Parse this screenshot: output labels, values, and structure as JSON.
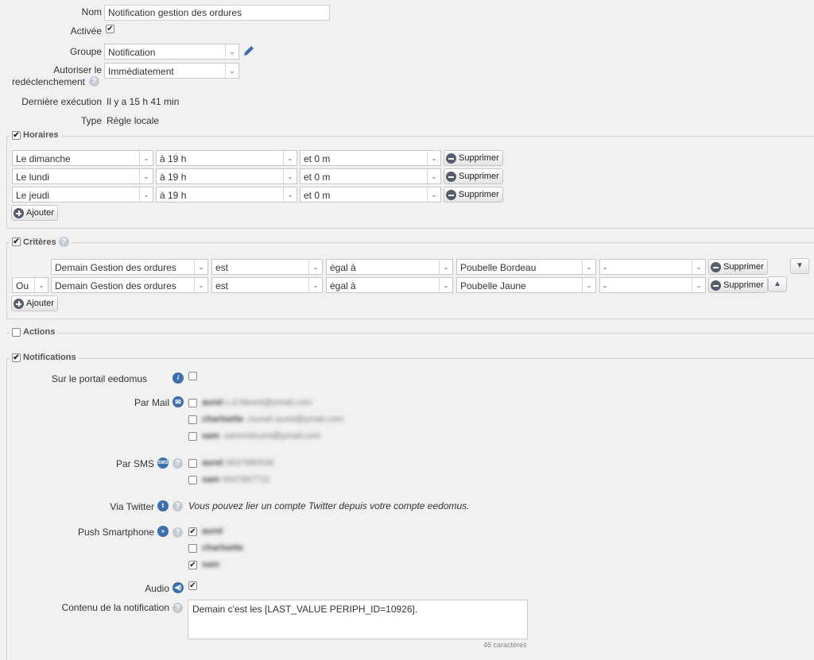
{
  "form": {
    "nom_label": "Nom",
    "nom_value": "Notification gestion des ordures",
    "activee_label": "Activée",
    "groupe_label": "Groupe",
    "groupe_value": "Notification",
    "autoriser_label_1": "Autoriser le",
    "autoriser_label_2": "redéclenchement",
    "autoriser_value": "Immédiatement",
    "derniere_label": "Dernière exécution",
    "derniere_value": "Il y a 15 h 41 min",
    "type_label": "Type",
    "type_value": "Règle locale"
  },
  "horaires": {
    "title": "Horaires",
    "rows": [
      {
        "day": "Le dimanche",
        "hour": "à 19 h",
        "minute": "et 0 m",
        "remove": "Supprimer"
      },
      {
        "day": "Le lundi",
        "hour": "à 19 h",
        "minute": "et 0 m",
        "remove": "Supprimer"
      },
      {
        "day": "Le jeudi",
        "hour": "à 19 h",
        "minute": "et 0 m",
        "remove": "Supprimer"
      }
    ],
    "add": "Ajouter"
  },
  "criteres": {
    "title": "Critères",
    "rows": [
      {
        "op": "",
        "device": "Demain Gestion des ordures",
        "verb": "est",
        "cmp": "égal à",
        "value": "Poubelle Bordeau",
        "extra": "-",
        "remove": "Supprimer"
      },
      {
        "op": "Ou",
        "device": "Demain Gestion des ordures",
        "verb": "est",
        "cmp": "égal à",
        "value": "Poubelle Jaune",
        "extra": "-",
        "remove": "Supprimer"
      }
    ],
    "add": "Ajouter"
  },
  "actions": {
    "title": "Actions"
  },
  "notifications": {
    "title": "Notifications",
    "portail_label": "Sur le portail eedomus",
    "mail_label": "Par Mail",
    "mail_entries": [
      {
        "name": "aurel",
        "detail": "c.d.hbumt@ymail.com"
      },
      {
        "name": "charlsette",
        "detail": ".rounet.auret@ymail.com"
      },
      {
        "name": "sam",
        "detail": ".sammstrumt@ymail.com"
      }
    ],
    "sms_label": "Par SMS",
    "sms_entries": [
      {
        "name": "aurel",
        "detail": "0637980536"
      },
      {
        "name": "sam",
        "detail": "0637667711"
      }
    ],
    "twitter_label": "Via Twitter",
    "twitter_text": "Vous pouvez lier un compte Twitter depuis votre compte eedomus.",
    "push_label": "Push Smartphone",
    "push_entries": [
      {
        "name": "aurel",
        "checked": true
      },
      {
        "name": "charlsette",
        "checked": false
      },
      {
        "name": "sam",
        "checked": true
      }
    ],
    "audio_label": "Audio",
    "contenu_label": "Contenu de la notification",
    "contenu_value": "Demain c'est les [LAST_VALUE PERIPH_ID=10926].",
    "char_count": "46 caractères"
  },
  "icons": {
    "check": "✔",
    "arrow_down": "▼",
    "arrow_up": "▲",
    "help": "?",
    "info": "i"
  }
}
